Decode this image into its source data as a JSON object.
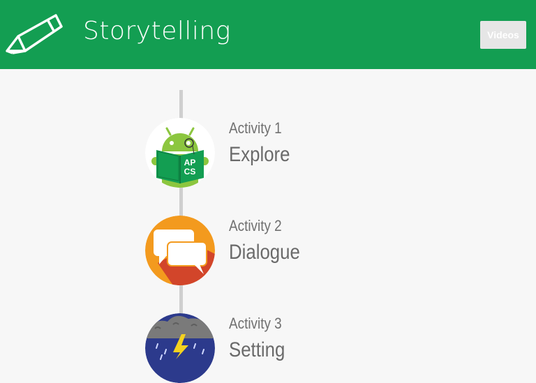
{
  "header": {
    "title": "Storytelling",
    "videos_label": "Videos",
    "background_color": "#139e52",
    "logo_icon": "pencil-icon"
  },
  "activities": [
    {
      "number_label": "Activity 1",
      "name": "Explore",
      "icon": "android-reading-book-icon",
      "badge_text_top": "AP",
      "badge_text_bottom": "CS"
    },
    {
      "number_label": "Activity 2",
      "name": "Dialogue",
      "icon": "speech-bubbles-icon"
    },
    {
      "number_label": "Activity 3",
      "name": "Setting",
      "icon": "storm-cloud-icon"
    }
  ]
}
